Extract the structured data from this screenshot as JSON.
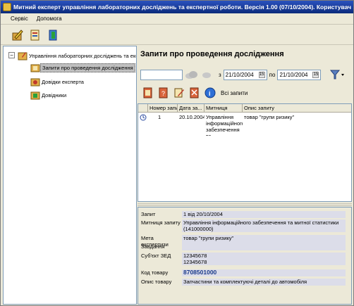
{
  "window": {
    "title": "Митний експерт управління лабораторних досліджень та експертної роботи. Версія 1.00 (07/10/2004). Користувач ..."
  },
  "menu": {
    "items": [
      "Сервіс",
      "Допомога"
    ]
  },
  "toolbar": {
    "buttons": [
      "pencil-tool-icon",
      "document-tool-icon",
      "exit-icon"
    ]
  },
  "tree": {
    "root": "Управління лабораторних досліджень та експе",
    "children": [
      "Запити про проведення дослідження",
      "Довідки експерта",
      "Довідники"
    ],
    "selected_index": 0
  },
  "main": {
    "title": "Запити про проведення дослідження",
    "filter": {
      "search_value": "",
      "from_label": "з",
      "from_date": "21/10/2004",
      "to_label": "по",
      "to_date": "21/10/2004"
    },
    "actions": {
      "all_requests_label": "Всі запити"
    },
    "grid": {
      "columns": [
        "Номер запи...",
        "Дата за...",
        "Митниця",
        "Опис запиту"
      ],
      "rows": [
        {
          "number": "1",
          "date": "20.10.2004",
          "customs": "Управління інформаційного забезпечення та",
          "description": "товар \"групи ризику\""
        }
      ]
    },
    "details": {
      "rows": [
        {
          "label": "Запит",
          "value": "1 від 20/10/2004"
        },
        {
          "label": "Митниця запиту",
          "value": "Управління інформаційного забезпечення та митної статистики (141000000)"
        },
        {
          "label": "Мета експертизи",
          "value": "товар \"групи ризику\""
        },
        {
          "label": "Завдання",
          "value": ""
        },
        {
          "label": "Суб'єкт ЗЕД",
          "value": "12345678\n12345678"
        },
        {
          "label": "Код товару",
          "value": "8708501000"
        },
        {
          "label": "Опис товару",
          "value": "Запчастини та комплектуючі деталі до автомобіля"
        }
      ]
    }
  },
  "colors": {
    "titlebar": "#0a246a",
    "selection": "#c0c0c0",
    "detail_value_bg": "#dcdde9",
    "code_text": "#1a3a8a"
  }
}
